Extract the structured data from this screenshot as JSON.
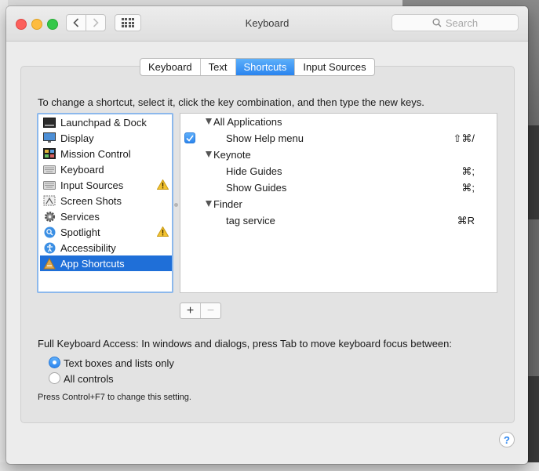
{
  "window": {
    "title": "Keyboard"
  },
  "search": {
    "placeholder": "Search"
  },
  "tabs": [
    {
      "label": "Keyboard",
      "active": false
    },
    {
      "label": "Text",
      "active": false
    },
    {
      "label": "Shortcuts",
      "active": true
    },
    {
      "label": "Input Sources",
      "active": false
    }
  ],
  "instruction": "To change a shortcut, select it, click the key combination, and then type the new keys.",
  "categories": [
    {
      "label": "Launchpad & Dock",
      "icon": "launchpad-dock-icon"
    },
    {
      "label": "Display",
      "icon": "display-icon"
    },
    {
      "label": "Mission Control",
      "icon": "mission-control-icon"
    },
    {
      "label": "Keyboard",
      "icon": "keyboard-icon"
    },
    {
      "label": "Input Sources",
      "icon": "input-sources-icon",
      "warning": true
    },
    {
      "label": "Screen Shots",
      "icon": "screen-shots-icon"
    },
    {
      "label": "Services",
      "icon": "services-gear-icon"
    },
    {
      "label": "Spotlight",
      "icon": "spotlight-icon",
      "warning": true
    },
    {
      "label": "Accessibility",
      "icon": "accessibility-icon"
    },
    {
      "label": "App Shortcuts",
      "icon": "app-shortcuts-icon",
      "selected": true
    }
  ],
  "shortcuts": {
    "groups": [
      {
        "name": "All Applications",
        "items": [
          {
            "name": "Show Help menu",
            "key": "⇧⌘/",
            "checked": true
          }
        ]
      },
      {
        "name": "Keynote",
        "items": [
          {
            "name": "Hide Guides",
            "key": "⌘;"
          },
          {
            "name": "Show Guides",
            "key": "⌘;"
          }
        ]
      },
      {
        "name": "Finder",
        "items": [
          {
            "name": "tag service",
            "key": "⌘R"
          }
        ]
      }
    ]
  },
  "buttons": {
    "add": "+",
    "remove": "−"
  },
  "full_keyboard_access": {
    "label": "Full Keyboard Access: In windows and dialogs, press Tab to move keyboard focus between:",
    "options": [
      {
        "label": "Text boxes and lists only",
        "selected": true
      },
      {
        "label": "All controls",
        "selected": false
      }
    ],
    "note": "Press Control+F7 to change this setting."
  },
  "help": {
    "label": "?"
  },
  "colors": {
    "accent": "#2a84ef",
    "selection": "#1f6fd8"
  }
}
